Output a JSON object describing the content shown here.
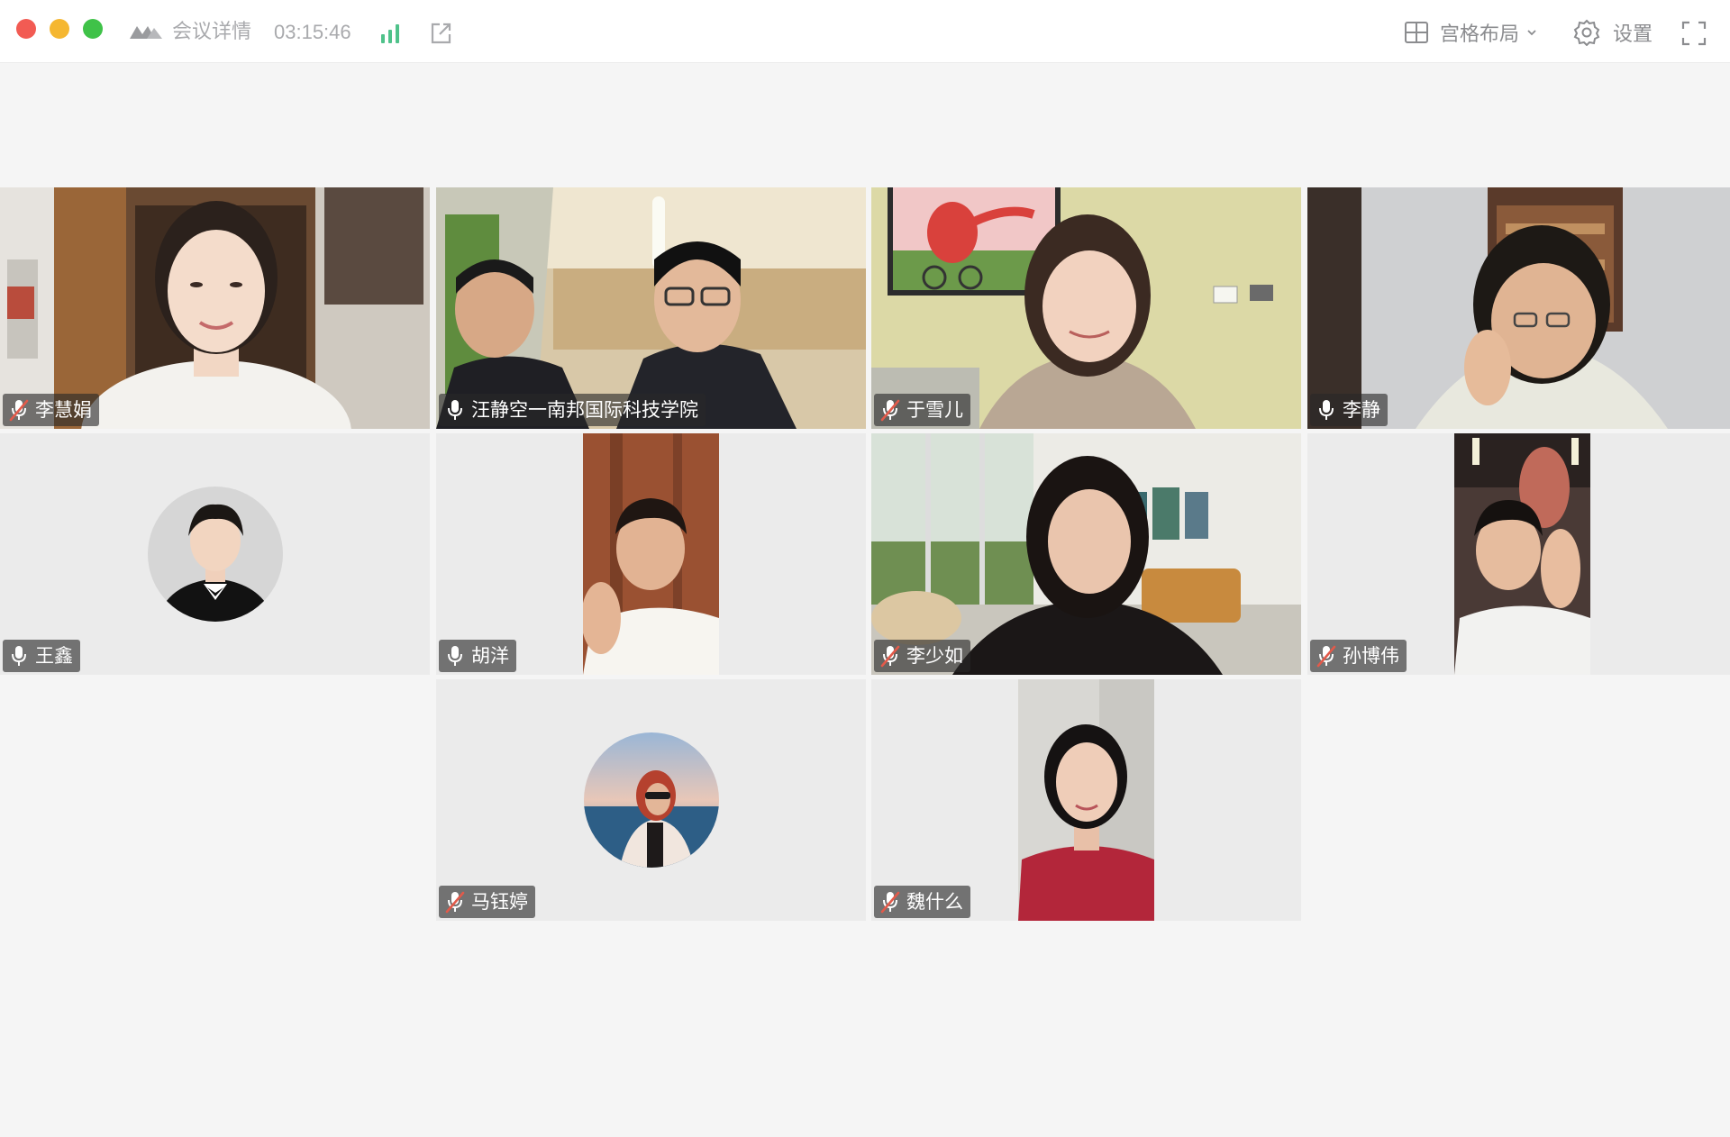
{
  "window": {
    "meeting_details_label": "会议详情",
    "elapsed_time": "03:15:46",
    "layout_label": "宫格布局",
    "settings_label": "设置"
  },
  "colors": {
    "traffic_red": "#f25b53",
    "traffic_yellow": "#f5b731",
    "traffic_green": "#3fc248",
    "active_speaker_border": "#4fc28a",
    "signal_green": "#4fc28a",
    "muted_slash": "#e25a4a"
  },
  "icons": {
    "logo": "app-logo-icon",
    "signal": "signal-bars-icon",
    "share": "external-share-icon",
    "layout": "grid-layout-icon",
    "settings": "gear-icon",
    "fullscreen": "fullscreen-icon"
  },
  "participants": [
    {
      "name": "李慧娟",
      "mic": "muted",
      "media": "camera"
    },
    {
      "name": "汪静空一南邦国际科技学院",
      "mic": "on",
      "media": "camera"
    },
    {
      "name": "于雪儿",
      "mic": "muted",
      "media": "camera"
    },
    {
      "name": "李静",
      "mic": "on",
      "media": "camera",
      "speaking": true
    },
    {
      "name": "王鑫",
      "mic": "on",
      "media": "avatar"
    },
    {
      "name": "胡洋",
      "mic": "on",
      "media": "camera-portrait"
    },
    {
      "name": "李少如",
      "mic": "muted",
      "media": "camera"
    },
    {
      "name": "孙博伟",
      "mic": "muted",
      "media": "camera-portrait"
    },
    {
      "name": "马钰婷",
      "mic": "muted",
      "media": "avatar"
    },
    {
      "name": "魏什么",
      "mic": "muted",
      "media": "camera-portrait"
    }
  ]
}
